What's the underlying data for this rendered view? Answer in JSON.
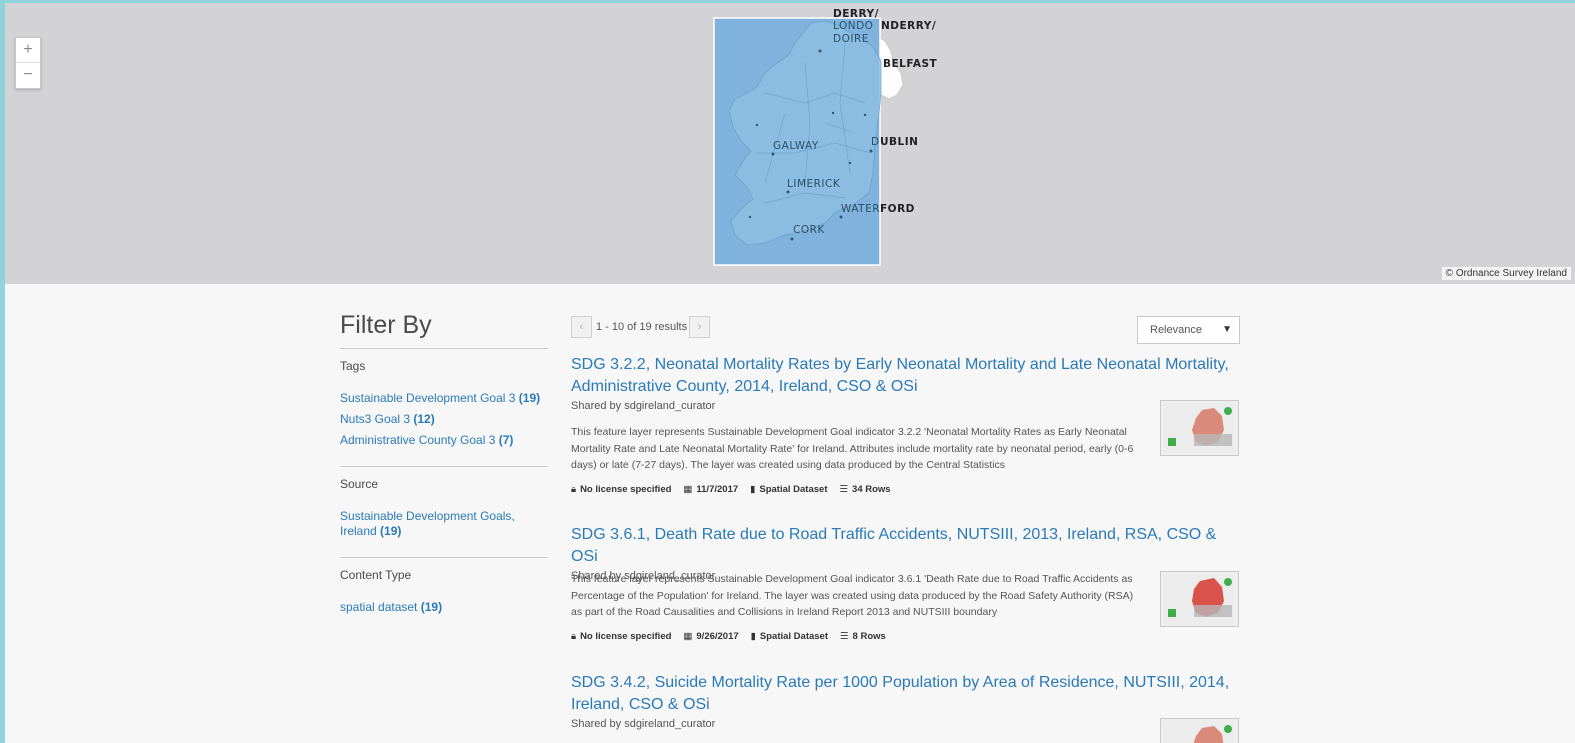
{
  "map": {
    "zoom_in": "+",
    "zoom_out": "−",
    "attribution": "© Ordnance Survey Ireland",
    "cities": {
      "derry_line1": "DERRY/",
      "derry_line2_inside": "LONDO",
      "derry_line2_outside": "NDERRY/",
      "derry_line3": "DOIRE",
      "belfast": "BELFAST",
      "galway": "GALWAY",
      "dublin_inside": "D",
      "dublin_outside": "UBLIN",
      "limerick": "LIMERICK",
      "waterford_inside": "WATER",
      "waterford_outside": "FORD",
      "cork": "CORK"
    }
  },
  "filter": {
    "title": "Filter By",
    "groups": [
      {
        "heading": "Tags",
        "items": [
          {
            "label": "Sustainable Development Goal 3",
            "count": "(19)"
          },
          {
            "label": "Nuts3 Goal 3",
            "count": "(12)"
          },
          {
            "label": "Administrative County Goal 3",
            "count": "(7)"
          }
        ]
      },
      {
        "heading": "Source",
        "items": [
          {
            "label": "Sustainable Development Goals, Ireland",
            "count": "(19)"
          }
        ]
      },
      {
        "heading": "Content Type",
        "items": [
          {
            "label": "spatial dataset",
            "count": "(19)"
          }
        ]
      }
    ]
  },
  "pager": {
    "prev": "‹",
    "next": "›",
    "info": "1 - 10 of 19 results"
  },
  "sort": {
    "selected": "Relevance",
    "caret": "▼"
  },
  "results": [
    {
      "title": "SDG 3.2.2, Neonatal Mortality Rates by Early Neonatal Mortality and Late Neonatal Mortality, Administrative County, 2014, Ireland, CSO & OSi",
      "shared": "Shared by sdgireland_curator",
      "description": "This feature layer represents Sustainable Development Goal indicator 3.2.2 'Neonatal Mortality Rates as Early Neonatal Mortality Rate and Late Neonatal Mortality Rate' for Ireland. Attributes include mortality rate by neonatal period, early (0-6 days) or late (7-27 days). The layer was created using data produced by the Central Statistics",
      "license": "No license specified",
      "date": "11/7/2017",
      "type": "Spatial Dataset",
      "rows": "34 Rows"
    },
    {
      "title": "SDG 3.6.1, Death Rate due to Road Traffic Accidents, NUTSIII, 2013, Ireland, RSA, CSO & OSi",
      "shared": "Shared by sdgireland_curator",
      "description": "This feature layer represents Sustainable Development Goal indicator 3.6.1 'Death Rate due to Road Traffic Accidents as Percentage of the Population' for Ireland. The layer was created using data produced by the Road Safety Authority (RSA) as part of the Road Causalities and Collisions in Ireland Report 2013 and NUTSIII boundary",
      "license": "No license specified",
      "date": "9/26/2017",
      "type": "Spatial Dataset",
      "rows": "8 Rows"
    },
    {
      "title": "SDG 3.4.2, Suicide Mortality Rate per 1000 Population by Area of Residence, NUTSIII, 2014, Ireland, CSO & OSi",
      "shared": "Shared by sdgireland_curator"
    }
  ],
  "colors": {
    "link": "#2a7ab8",
    "map_bg": "#d3d3d6",
    "extent_fill": "#7fb3de",
    "page_bg": "#f7f7f7"
  }
}
